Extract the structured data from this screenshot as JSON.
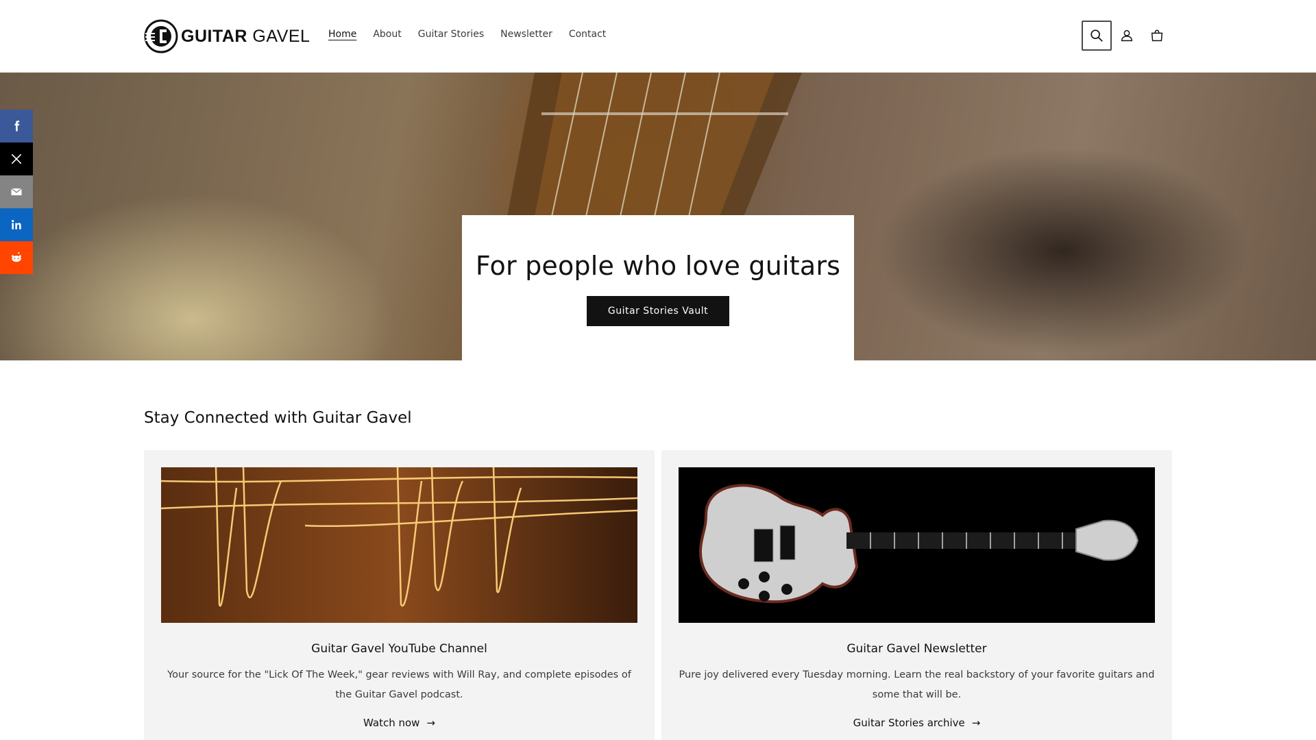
{
  "header": {
    "logo": {
      "bold": "GUITAR",
      "thin": " GAVEL"
    },
    "nav": [
      {
        "label": "Home",
        "active": true
      },
      {
        "label": "About"
      },
      {
        "label": "Guitar Stories"
      },
      {
        "label": "Newsletter"
      },
      {
        "label": "Contact"
      }
    ],
    "icons": [
      "search-icon",
      "account-icon",
      "cart-icon"
    ]
  },
  "hero": {
    "title": "For people who love guitars",
    "button": "Guitar Stories Vault"
  },
  "share": [
    {
      "name": "facebook",
      "color": "#3b5998"
    },
    {
      "name": "x",
      "color": "#000000"
    },
    {
      "name": "email",
      "color": "#848484"
    },
    {
      "name": "linkedin",
      "color": "#0b66c2"
    },
    {
      "name": "reddit",
      "color": "#ff4500"
    }
  ],
  "section": {
    "title": "Stay Connected with Guitar Gavel",
    "cards": [
      {
        "title": "Guitar Gavel YouTube Channel",
        "text": "Your source for the \"Lick Of The Week,\" gear reviews with Will Ray, and complete episodes of the Guitar Gavel podcast.",
        "link": "Watch now"
      },
      {
        "title": "Guitar Gavel Newsletter",
        "text": "Pure joy delivered every Tuesday morning. Learn the real backstory of your favorite guitars and some that will be.",
        "link": "Guitar Stories archive"
      }
    ]
  }
}
